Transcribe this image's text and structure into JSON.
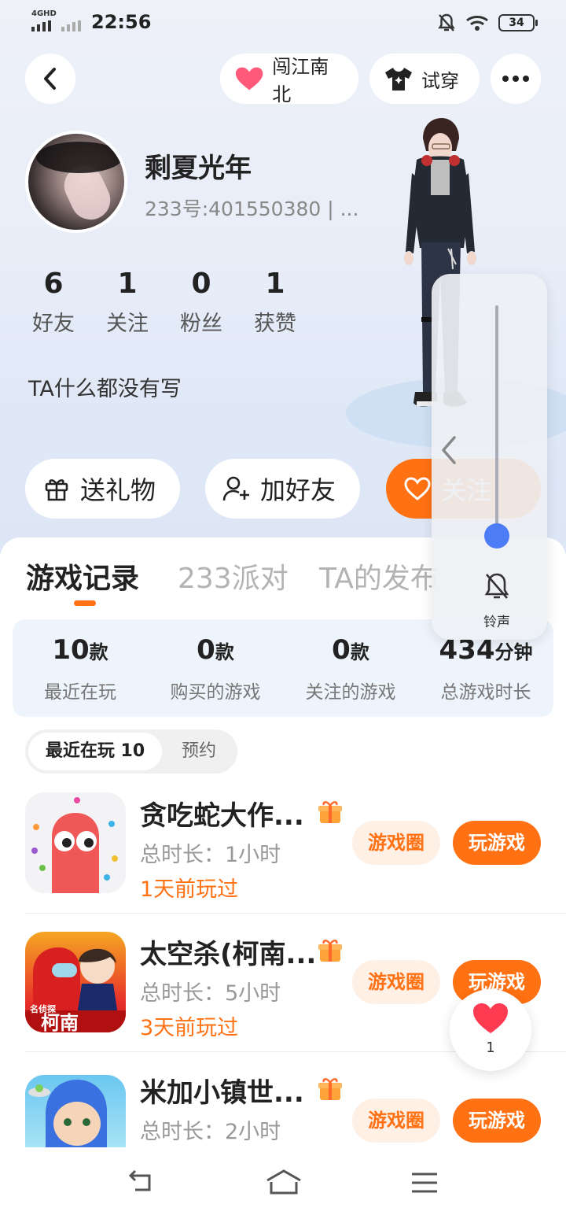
{
  "status_bar": {
    "network": "4GHD",
    "time": "22:56",
    "battery": "34"
  },
  "header": {
    "tag_label": "闯江南北",
    "try_on_label": "试穿"
  },
  "profile": {
    "nickname": "剩夏光年",
    "uid": "233号:401550380 | ...",
    "stats": [
      {
        "value": "6",
        "label": "好友"
      },
      {
        "value": "1",
        "label": "关注"
      },
      {
        "value": "0",
        "label": "粉丝"
      },
      {
        "value": "1",
        "label": "获赞"
      }
    ],
    "bio": "TA什么都没有写"
  },
  "actions": {
    "gift": "送礼物",
    "add_friend": "加好友",
    "follow": "关注"
  },
  "tabs": [
    "游戏记录",
    "233派对",
    "TA的发布"
  ],
  "summary": [
    {
      "value": "10",
      "unit": "款",
      "label": "最近在玩"
    },
    {
      "value": "0",
      "unit": "款",
      "label": "购买的游戏"
    },
    {
      "value": "0",
      "unit": "款",
      "label": "关注的游戏"
    },
    {
      "value": "434",
      "unit": "分钟",
      "label": "总游戏时长"
    }
  ],
  "filters": {
    "recent": "最近在玩 10",
    "reserve": "预约"
  },
  "games": [
    {
      "name": "贪吃蛇大作...",
      "duration": "总时长：1小时",
      "last_played": "1天前玩过",
      "circle": "游戏圈",
      "play": "玩游戏"
    },
    {
      "name": "太空杀(柯南...",
      "duration": "总时长：5小时",
      "last_played": "3天前玩过",
      "circle": "游戏圈",
      "play": "玩游戏"
    },
    {
      "name": "米加小镇世...",
      "duration": "总时长：2小时",
      "last_played": "",
      "circle": "游戏圈",
      "play": "玩游戏"
    }
  ],
  "icon_texts": {
    "conan_badge": "名侦探",
    "conan_title": "柯南"
  },
  "volume_overlay": {
    "label": "铃声",
    "level": 0.08
  },
  "like_float": {
    "count": "1"
  },
  "colors": {
    "accent": "#ff7112",
    "volume_knob": "#4d7cf7"
  },
  "icons": [
    "back-icon",
    "heart-icon",
    "shirt-icon",
    "more-icon",
    "gift-icon",
    "add-user-icon",
    "bell-mute-icon",
    "nav-back-icon",
    "nav-home-icon",
    "nav-menu-icon"
  ]
}
